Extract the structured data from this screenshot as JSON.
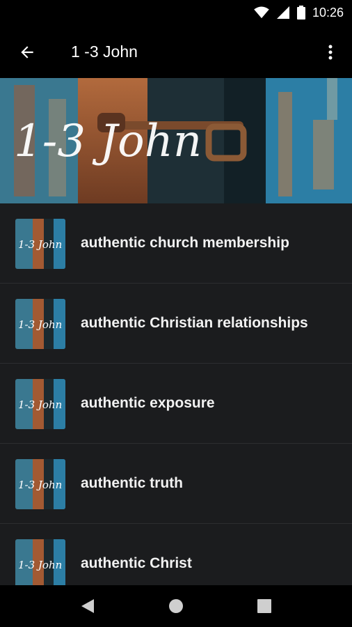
{
  "status_bar": {
    "time": "10:26",
    "icons": [
      "wifi-icon",
      "signal-icon",
      "battery-icon"
    ]
  },
  "app_bar": {
    "title": "1 -3 John",
    "back_icon": "arrow-back-icon",
    "menu_icon": "more-vert-icon"
  },
  "banner": {
    "text": "1-3 John"
  },
  "list": {
    "items": [
      {
        "label": "authentic church membership",
        "thumb_text": "1-3 John"
      },
      {
        "label": "authentic Christian relationships",
        "thumb_text": "1-3 John"
      },
      {
        "label": "authentic exposure",
        "thumb_text": "1-3 John"
      },
      {
        "label": "authentic truth",
        "thumb_text": "1-3 John"
      },
      {
        "label": "authentic Christ",
        "thumb_text": "1-3 John"
      }
    ]
  },
  "nav_bar": {
    "icons": [
      "nav-back-icon",
      "nav-home-icon",
      "nav-recents-icon"
    ]
  },
  "colors": {
    "background": "#1b1c1e",
    "bar": "#000000",
    "divider": "#2c2d30",
    "text": "#f2f2f2"
  }
}
